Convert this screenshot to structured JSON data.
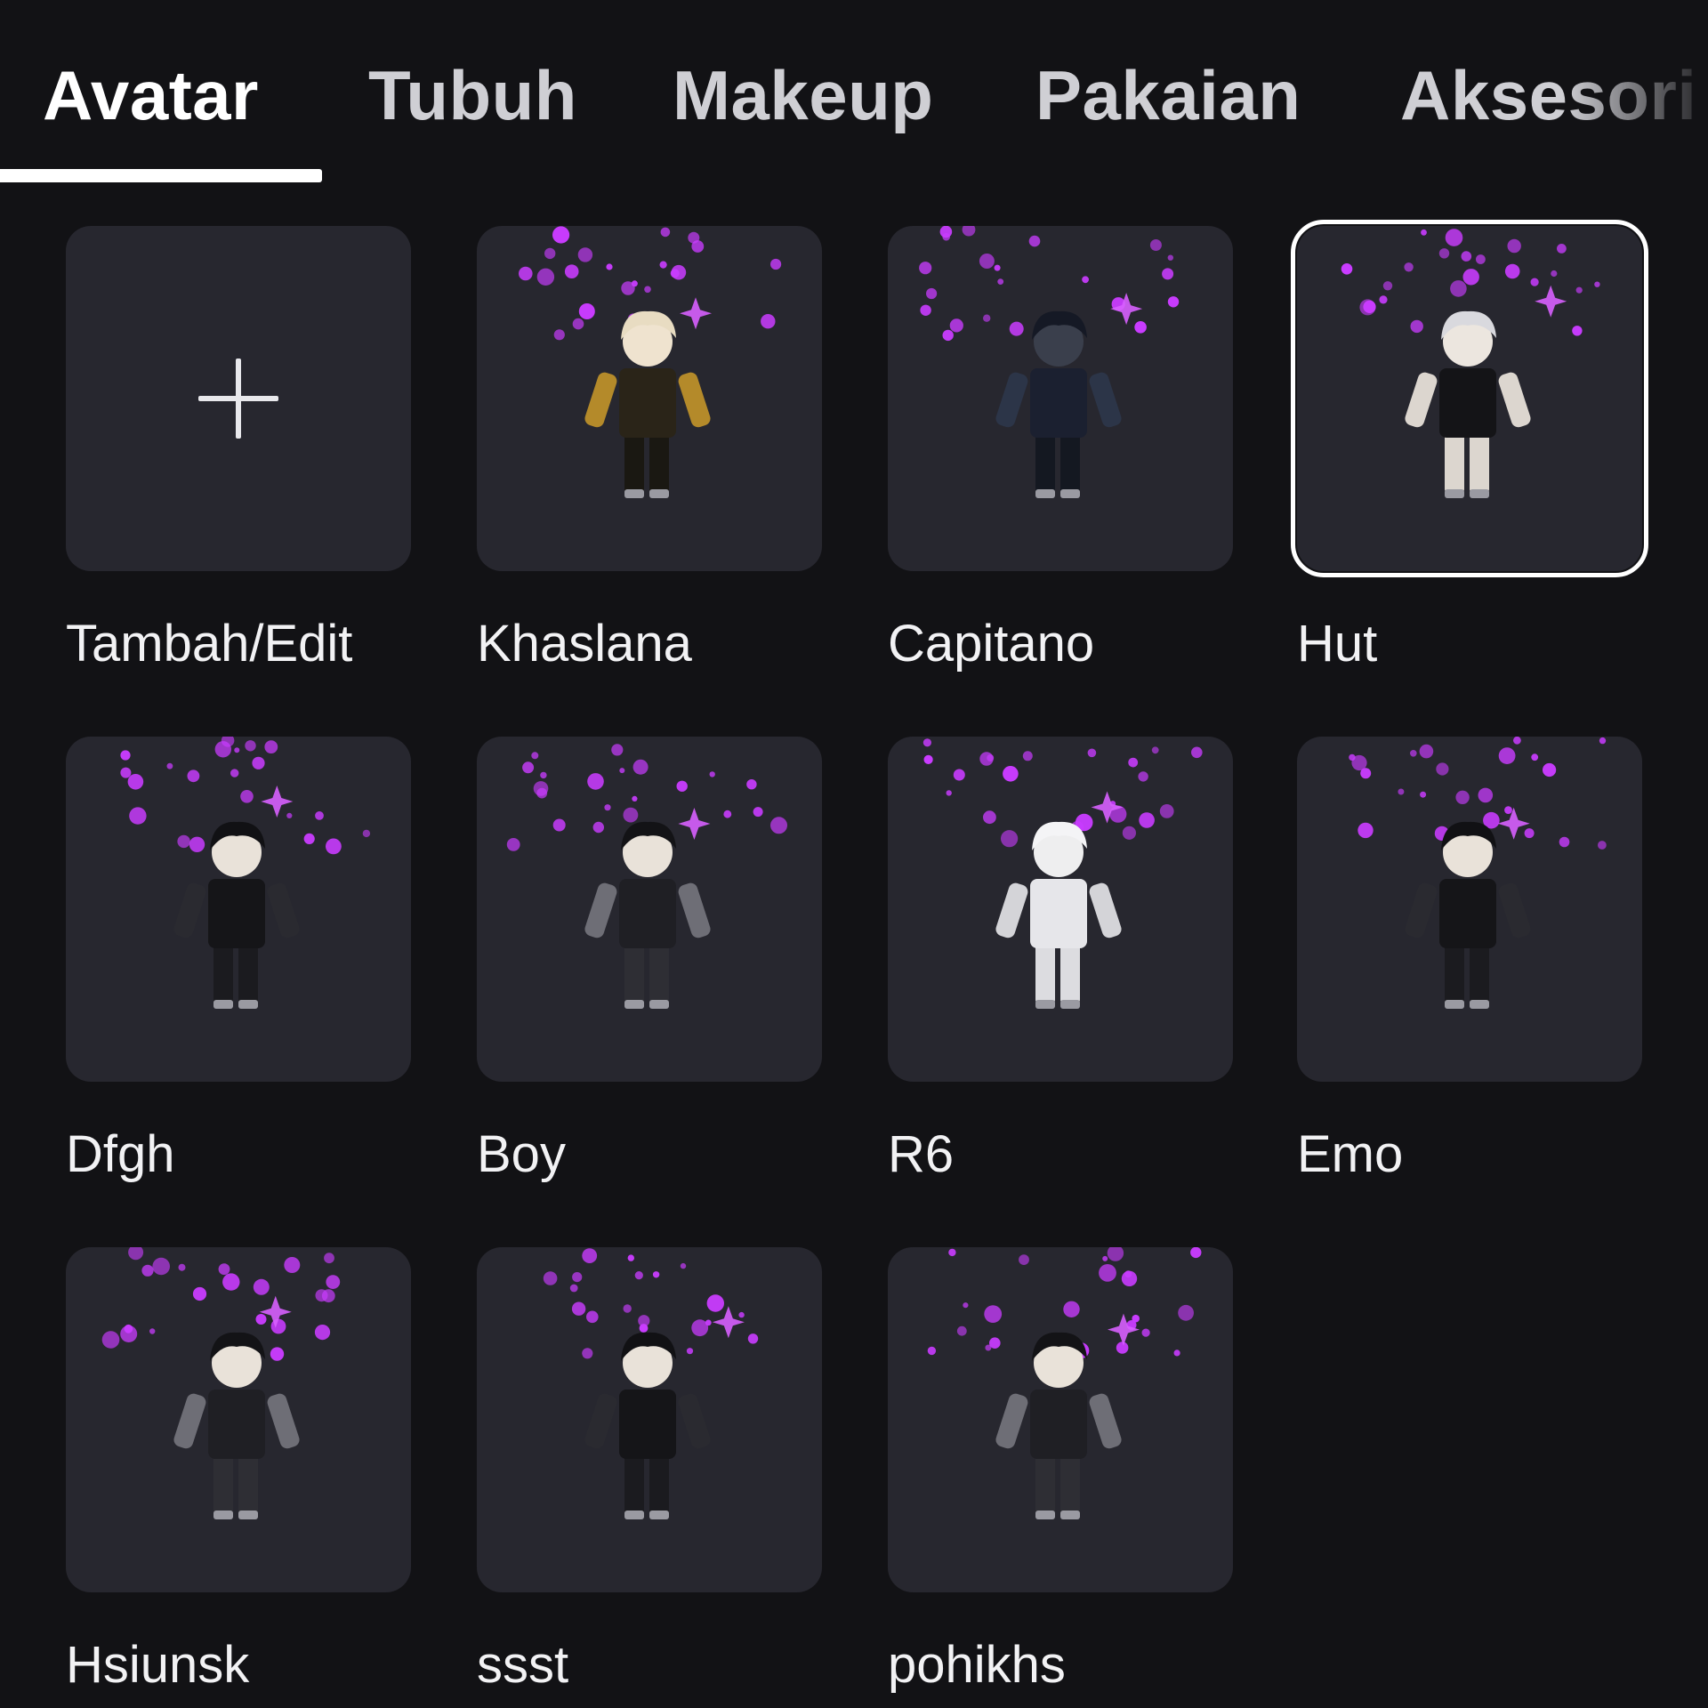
{
  "tabs": [
    {
      "label": "Avatar",
      "active": true
    },
    {
      "label": "Tubuh",
      "active": false
    },
    {
      "label": "Makeup",
      "active": false
    },
    {
      "label": "Pakaian",
      "active": false
    },
    {
      "label": "Aksesori",
      "active": false
    }
  ],
  "outfits": [
    {
      "name": "Tambah/Edit",
      "kind": "add",
      "icon": "plus-icon",
      "selected": false
    },
    {
      "name": "Khaslana",
      "kind": "avatar",
      "icon": "avatar-thumbnail",
      "selected": false
    },
    {
      "name": "Capitano",
      "kind": "avatar",
      "icon": "avatar-thumbnail",
      "selected": false
    },
    {
      "name": "Hut",
      "kind": "avatar",
      "icon": "avatar-thumbnail",
      "selected": true
    },
    {
      "name": "Dfgh",
      "kind": "avatar",
      "icon": "avatar-thumbnail",
      "selected": false
    },
    {
      "name": "Boy",
      "kind": "avatar",
      "icon": "avatar-thumbnail",
      "selected": false
    },
    {
      "name": "R6",
      "kind": "avatar",
      "icon": "avatar-thumbnail",
      "selected": false
    },
    {
      "name": "Emo",
      "kind": "avatar",
      "icon": "avatar-thumbnail",
      "selected": false
    },
    {
      "name": "Hsiunsk",
      "kind": "avatar",
      "icon": "avatar-thumbnail",
      "selected": false
    },
    {
      "name": "ssst",
      "kind": "avatar",
      "icon": "avatar-thumbnail",
      "selected": false
    },
    {
      "name": "pohikhs",
      "kind": "avatar",
      "icon": "avatar-thumbnail",
      "selected": false
    }
  ],
  "colors": {
    "background": "#121215",
    "card": "#27272f",
    "text": "#f2f2f4",
    "sparkle": "#c93cff",
    "selected_border": "#ffffff"
  }
}
